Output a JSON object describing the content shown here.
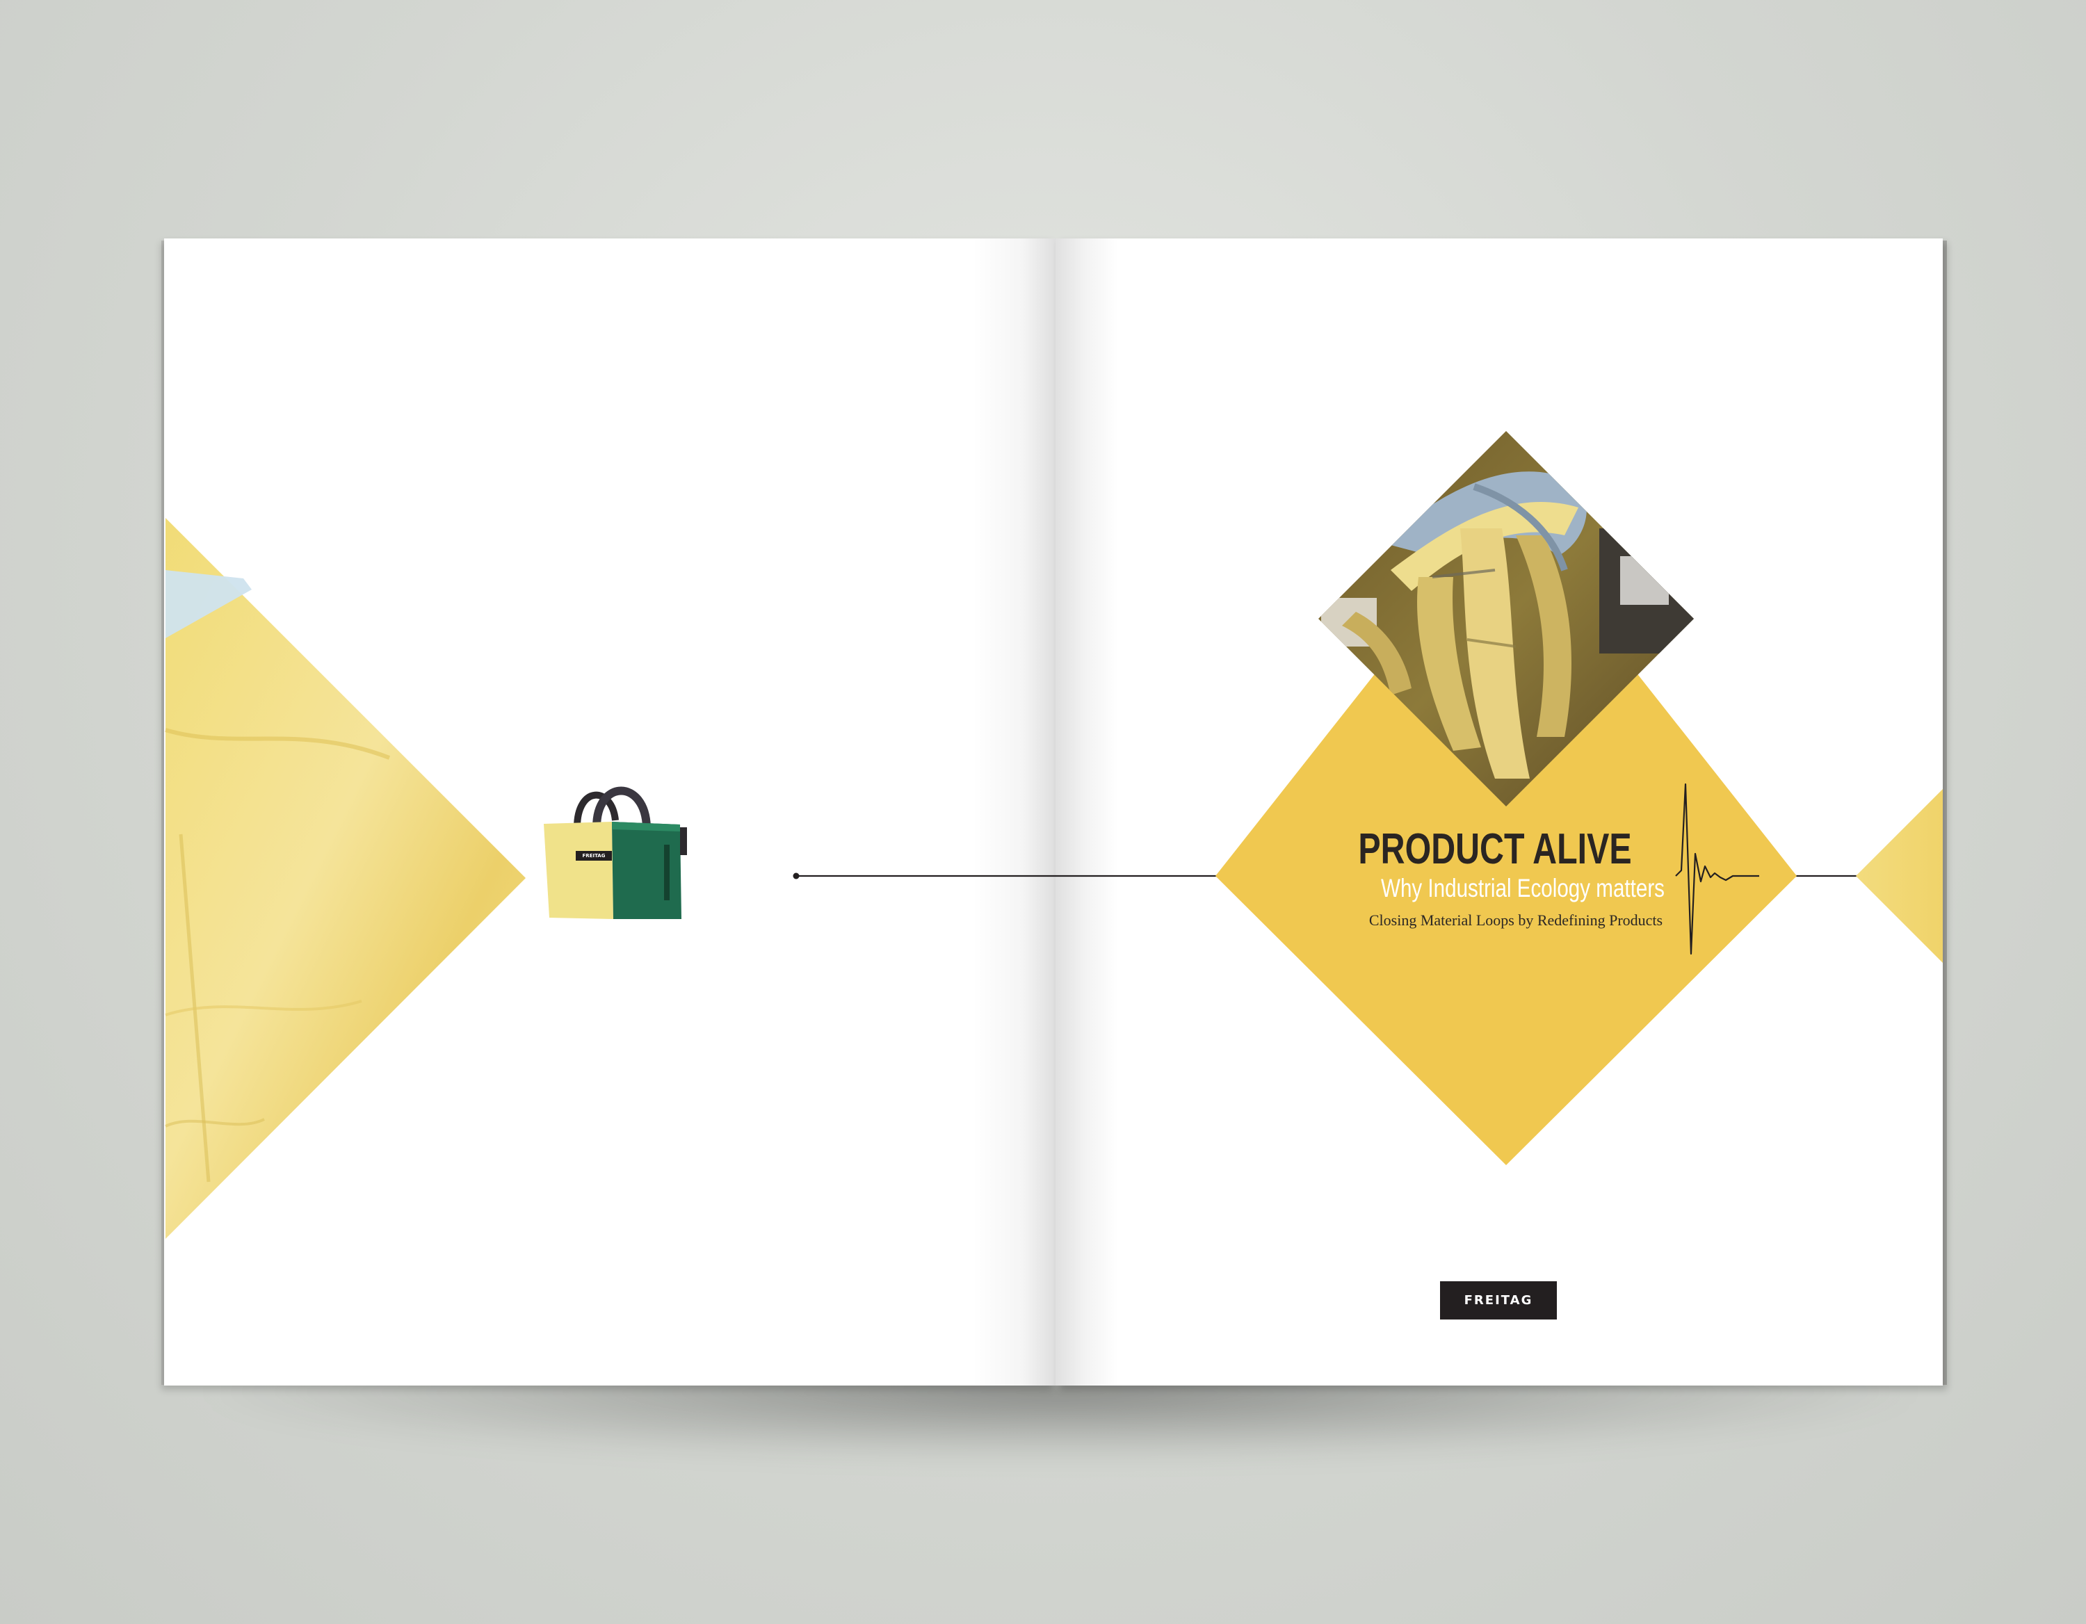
{
  "spread": {
    "title": "PRODUCT ALIVE",
    "subtitle": "Why Industrial Ecology matters",
    "tagline": "Closing Material Loops by Redefining Products",
    "logo_text": "FREITAG",
    "bag_tag_text": "FREITAG"
  },
  "colors": {
    "accent_yellow": "#f0c850",
    "pale_yellow": "#f2dc7a",
    "bag_green": "#1f6b4e",
    "ink": "#231f20",
    "background": "#d3d6d1"
  },
  "icons": {
    "pulse": "heartbeat-line-icon",
    "bag": "messenger-bag-image"
  }
}
